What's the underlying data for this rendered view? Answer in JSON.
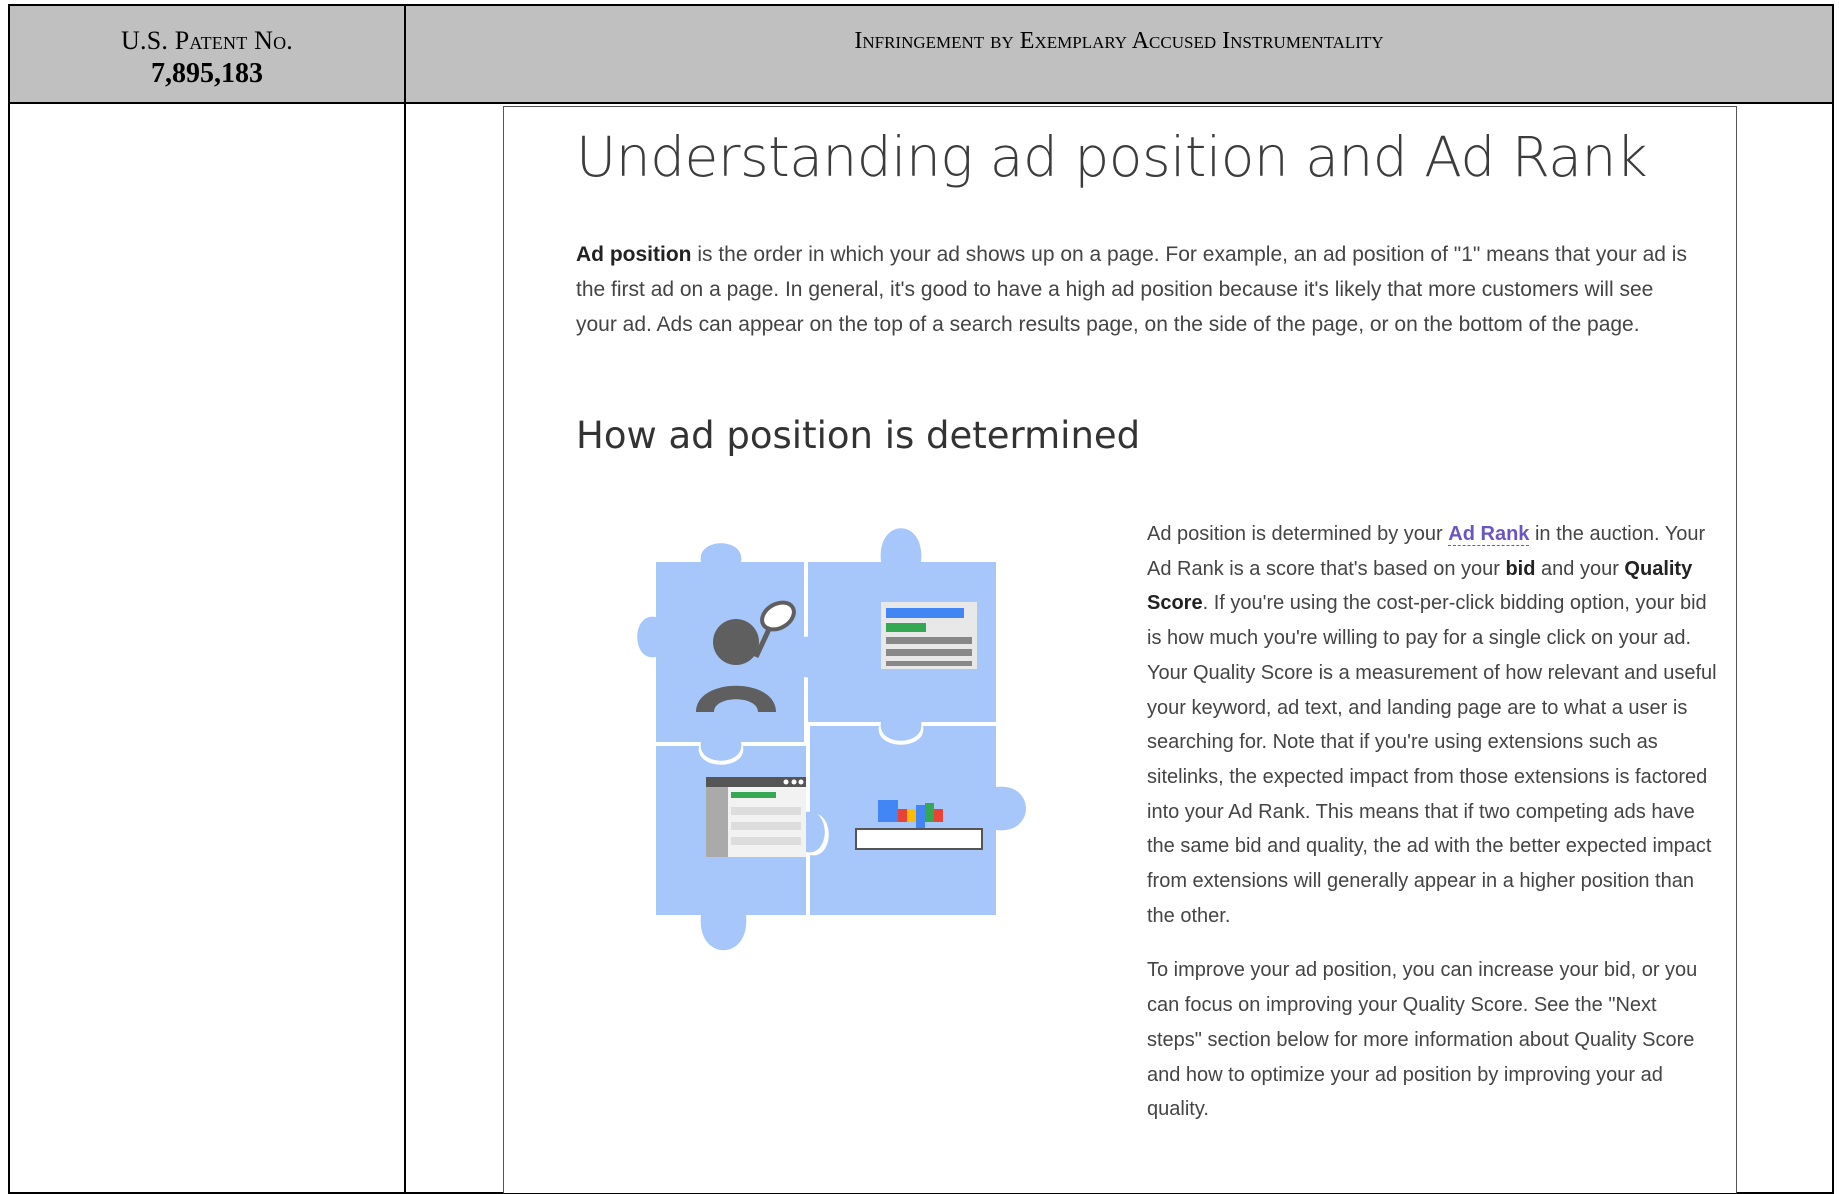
{
  "header": {
    "patent_label": "U.S. Patent No.",
    "patent_number": "7,895,183",
    "title": "Infringement by Exemplary Accused Instrumentality"
  },
  "screenshot": {
    "title": "Understanding ad position and Ad Rank",
    "intro": {
      "term": "Ad position",
      "text": " is the order in which your ad shows up on a page. For example, an ad position of \"1\" means that your ad is the first ad on a page. In general, it's good to have a high ad position because it's likely that more customers will see your ad. Ads can appear on the top of a search results page, on the side of the page, or on the bottom of the page."
    },
    "subheading": "How ad position is determined",
    "paragraph1": {
      "p1": "Ad position is determined by your ",
      "link": "Ad Rank",
      "p2": " in the auction. Your Ad Rank is a score that's based on your ",
      "bid": "bid",
      "p3": " and your ",
      "quality": "Quality Score",
      "p4": ". If you're using the cost-per-click bidding option, your bid is how much you're willing to pay for a single click on your ad. Your Quality Score is a measurement of how relevant and useful your keyword, ad text, and landing page are to what a user is searching for. Note that if you're using extensions such as sitelinks, the expected impact from those extensions is factored into your Ad Rank.  This means that if two competing ads have the same bid and quality, the ad with the better expected impact from extensions will generally appear in a higher position than the other."
    },
    "paragraph2": "To improve your ad position, you can increase your bid, or you can focus on improving your Quality Score. See the \"Next steps\" section below for more information about Quality Score and how to optimize your ad position by improving your ad quality.",
    "illustration": {
      "icon": "puzzle-illustration",
      "colors": {
        "piece_main": "#a7c7fa",
        "piece_shade": "#8eb4f2",
        "person": "#5f5f5f",
        "blue": "#4285f4",
        "red": "#ea4335",
        "yellow": "#fbbc05",
        "green": "#34a853"
      }
    }
  }
}
